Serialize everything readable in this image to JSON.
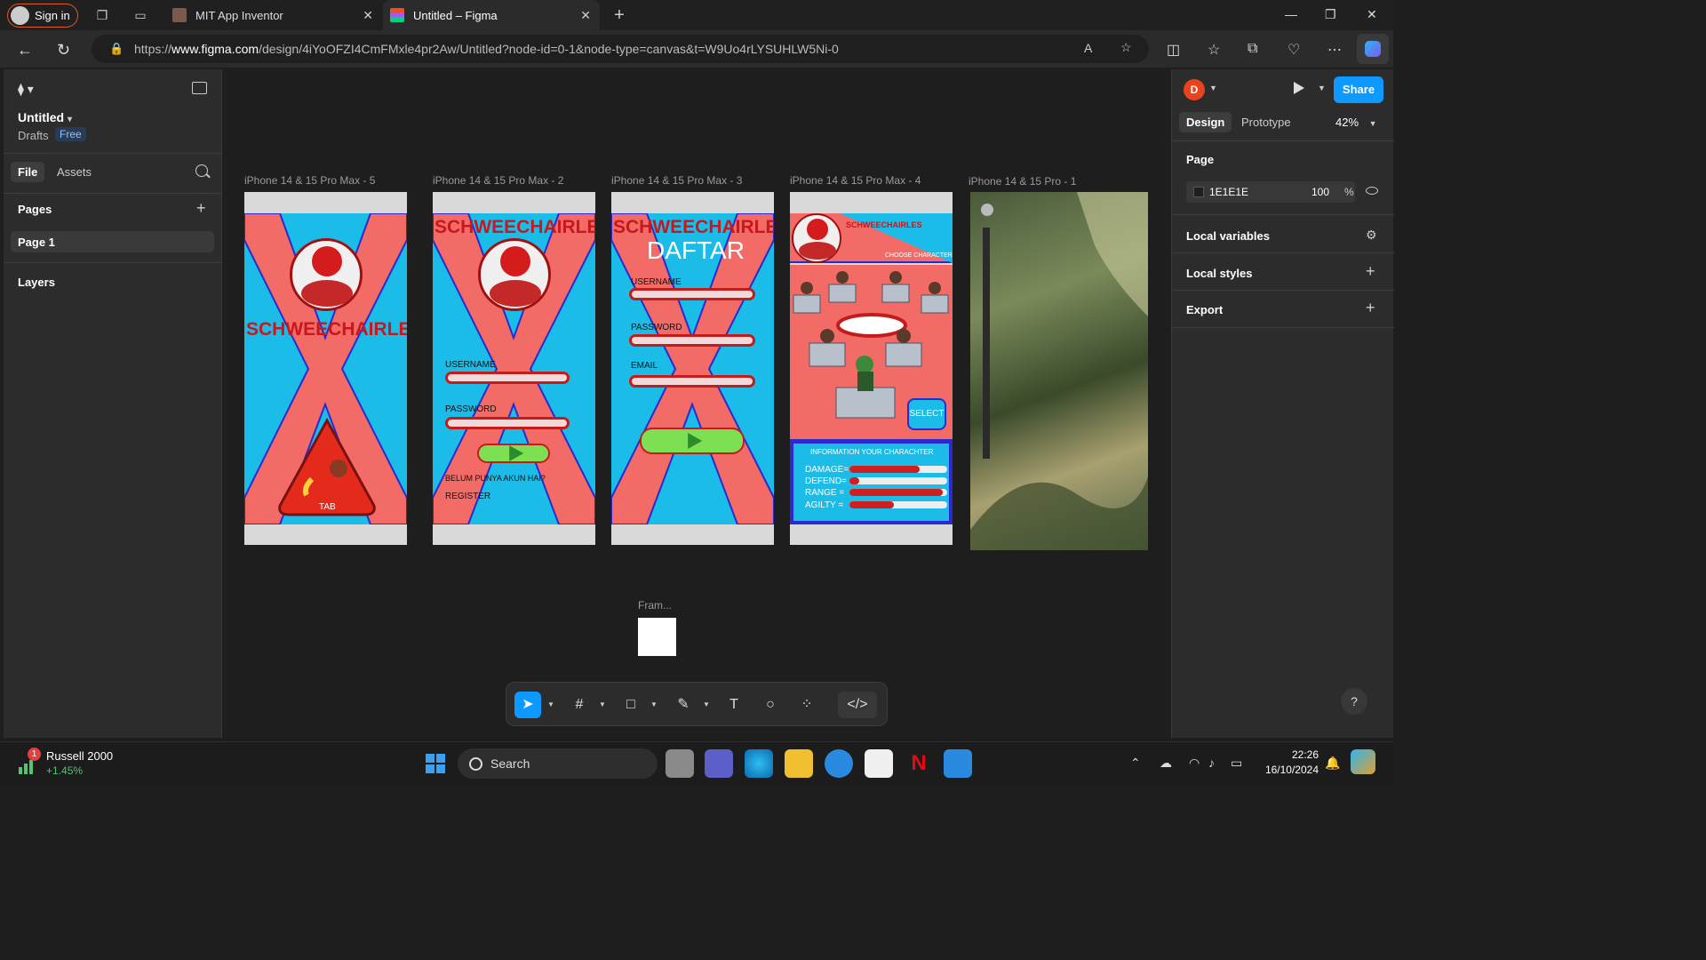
{
  "browser": {
    "signin_label": "Sign in",
    "tabs": [
      {
        "title": "MIT App Inventor"
      },
      {
        "title": "Untitled – Figma"
      }
    ],
    "url_prefix": "https://",
    "url_host": "www.figma.com",
    "url_path": "/design/4iYoOFZI4CmFMxle4pr2Aw/Untitled?node-id=0-1&node-type=canvas&t=W9Uo4rLYSUHLW5Ni-0"
  },
  "figma": {
    "doc_title": "Untitled",
    "drafts": "Drafts",
    "plan_badge": "Free",
    "left_tabs": [
      "File",
      "Assets"
    ],
    "pages_heading": "Pages",
    "pages": [
      "Page 1"
    ],
    "layers_heading": "Layers",
    "user_initial": "D",
    "share_label": "Share",
    "right_tabs": [
      "Design",
      "Prototype"
    ],
    "zoom": "42%",
    "page_section": "Page",
    "bg_color_hex": "1E1E1E",
    "bg_opacity": "100",
    "pct_sign": "%",
    "local_variables": "Local variables",
    "local_styles": "Local styles",
    "export": "Export",
    "help": "?"
  },
  "frames": {
    "labels": [
      "iPhone 14 & 15 Pro Max - 5",
      "iPhone 14 & 15 Pro Max - 2",
      "iPhone 14 & 15 Pro Max - 3",
      "iPhone 14 & 15 Pro Max - 4",
      "iPhone 14 & 15 Pro - 1"
    ],
    "small_frame_label": "Fram...",
    "f5": {
      "title": "SCHWEECHAIRLES",
      "tab_label": "TAB"
    },
    "f2": {
      "title": "SCHWEECHAIRLES",
      "username": "USERNAME",
      "password": "PASSWORD",
      "no_account": "BELUM PUNYA AKUN HAI?",
      "register": "REGISTER"
    },
    "f3": {
      "title": "SCHWEECHAIRLES",
      "subtitle": "DAFTAR",
      "username": "USERNAME",
      "password": "PASSWORD",
      "email": "EMAIL"
    },
    "f4": {
      "title": "SCHWEECHAIRLES",
      "choose": "CHOOSE CHARACTER",
      "select": "SELECT",
      "info_title": "INFORMATION YOUR CHARACHTER",
      "stats": [
        {
          "label": "DAMAGE=",
          "value": 0.72
        },
        {
          "label": "DEFEND=",
          "value": 0.1
        },
        {
          "label": "RANGE  =",
          "value": 0.95
        },
        {
          "label": "AGILTY  =",
          "value": 0.45
        }
      ]
    }
  },
  "taskbar": {
    "stock_name": "Russell 2000",
    "stock_change": "+1.45%",
    "stock_badge": "1",
    "search_label": "Search",
    "time": "22:26",
    "date": "16/10/2024"
  },
  "colors": {
    "accent": "#0d99ff",
    "frame_blue": "#1bbde8",
    "frame_red": "#f26b66",
    "title_red": "#c8171d"
  }
}
